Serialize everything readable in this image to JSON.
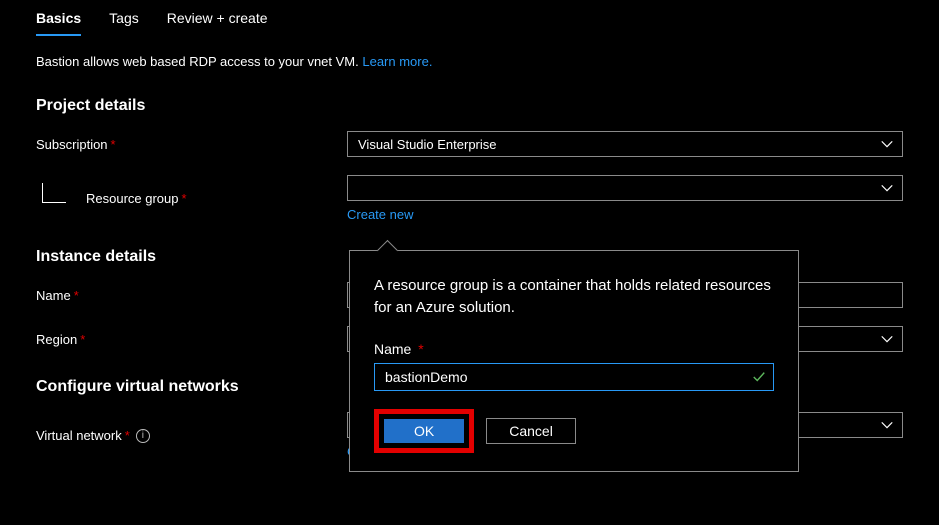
{
  "tabs": {
    "basics": "Basics",
    "tags": "Tags",
    "review": "Review + create"
  },
  "intro": {
    "text": "Bastion allows web based RDP access to your vnet VM.  ",
    "link": "Learn more."
  },
  "sections": {
    "project": "Project details",
    "instance": "Instance details",
    "vnet": "Configure virtual networks"
  },
  "labels": {
    "subscription": "Subscription",
    "resource_group": "Resource group",
    "name": "Name",
    "region": "Region",
    "virtual_network": "Virtual network",
    "create_new": "Create new"
  },
  "values": {
    "subscription": "Visual Studio Enterprise",
    "resource_group": "",
    "name": "",
    "region": "",
    "virtual_network": ""
  },
  "popover": {
    "desc": "A resource group is a container that holds related resources for an Azure solution.",
    "name_label": "Name",
    "name_value": "bastionDemo",
    "ok": "OK",
    "cancel": "Cancel"
  }
}
